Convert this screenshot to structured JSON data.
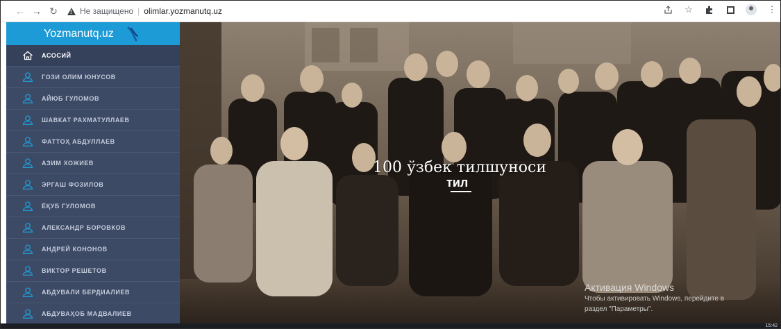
{
  "browser": {
    "security_text": "Не защищено",
    "separator": "|",
    "url": "olimlar.yozmanutq.uz",
    "icons": [
      "back-icon",
      "forward-icon",
      "reload-icon",
      "warning-icon",
      "share-icon",
      "star-icon",
      "extensions-icon",
      "sidepanel-icon",
      "profile-icon",
      "menu-icon"
    ]
  },
  "sidebar": {
    "brand": "Yozmanutq.uz",
    "items": [
      {
        "label": "Асосий",
        "icon": "home-icon",
        "active": true
      },
      {
        "label": "Гози Олим Юнусов",
        "icon": "user-icon"
      },
      {
        "label": "Айюб Гуломов",
        "icon": "user-icon"
      },
      {
        "label": "Шавкат Рахматуллаев",
        "icon": "user-icon"
      },
      {
        "label": "Фаттоҳ Абдуллаев",
        "icon": "user-icon"
      },
      {
        "label": "Азим Хожиев",
        "icon": "user-icon"
      },
      {
        "label": "Эргаш Фозилов",
        "icon": "user-icon"
      },
      {
        "label": "Ёқуб Гуломов",
        "icon": "user-icon"
      },
      {
        "label": "Александр Боровков",
        "icon": "user-icon"
      },
      {
        "label": "Андрей Кононов",
        "icon": "user-icon"
      },
      {
        "label": "Виктор Решетов",
        "icon": "user-icon"
      },
      {
        "label": "Абдували Бердиалиев",
        "icon": "user-icon"
      },
      {
        "label": "Абдуваҳоб Мадвалиев",
        "icon": "user-icon"
      }
    ]
  },
  "hero": {
    "title": "100 ўзбек тилшуноси",
    "subtitle": "тил"
  },
  "watermark": {
    "title": "Активация Windows",
    "line1": "Чтобы активировать Windows, перейдите в",
    "line2": "раздел \"Параметры\"."
  },
  "taskbar": {
    "time": "15:42"
  },
  "colors": {
    "brand_bar": "#1d9bd6",
    "sidebar_bg": "#3d4a65",
    "menu_text": "#c3cbdb",
    "accent": "#1d9bd6"
  }
}
